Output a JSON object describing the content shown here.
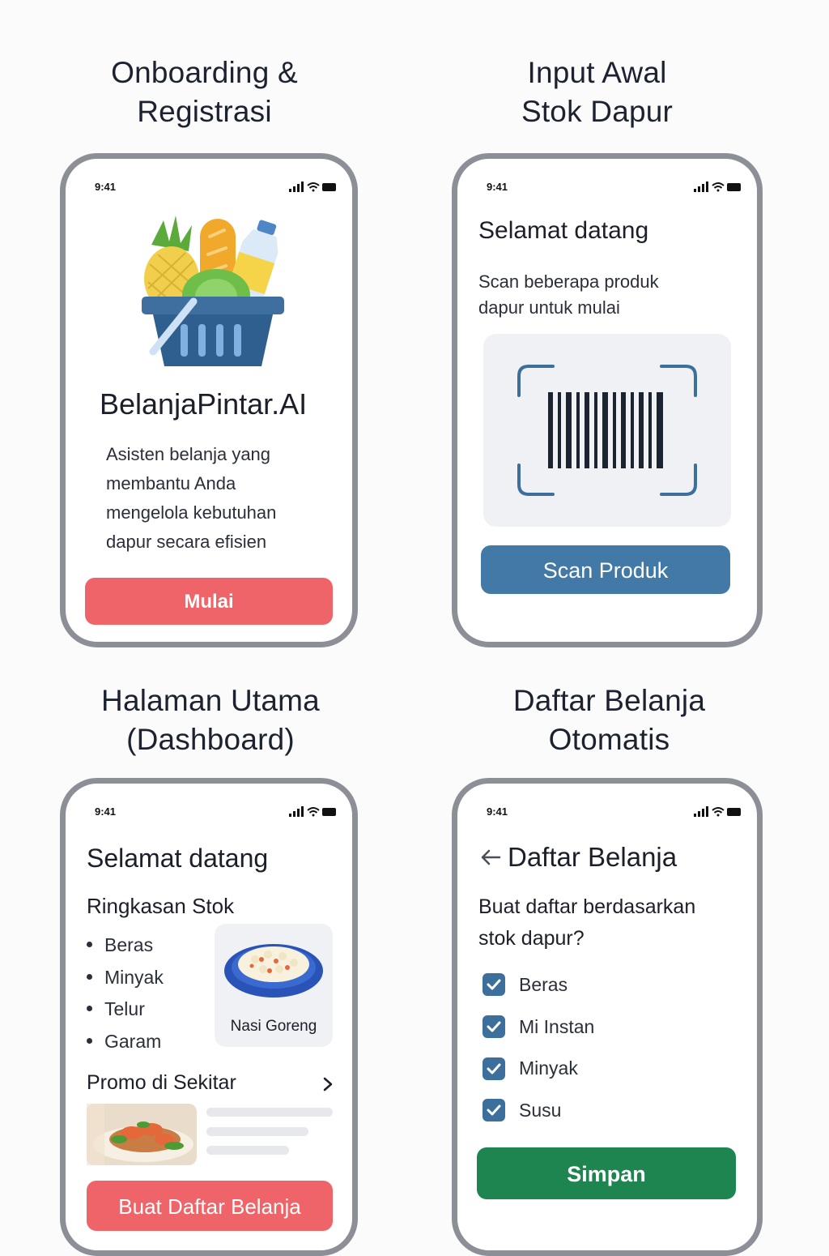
{
  "sections": [
    {
      "title_line1": "Onboarding &",
      "title_line2": "Registrasi"
    },
    {
      "title_line1": "Input Awal",
      "title_line2": "Stok Dapur"
    },
    {
      "title_line1": "Halaman Utama",
      "title_line2": "(Dashboard)"
    },
    {
      "title_line1": "Daftar Belanja",
      "title_line2": "Otomatis"
    }
  ],
  "status_time": "9:41",
  "onboarding": {
    "brand": "BelanjaPintar.AI",
    "description_lines": [
      "Asisten belanja yang",
      "membantu Anda",
      "mengelola kebutuhan",
      "dapur secara efisien"
    ],
    "button_label": "Mulai",
    "illustration_icon": "grocery-basket-icon"
  },
  "input_stok": {
    "title": "Selamat datang",
    "description_lines": [
      "Scan beberapa produk",
      "dapur untuk mulai"
    ],
    "scanner_icon": "barcode-scan-icon",
    "button_label": "Scan Produk"
  },
  "dashboard": {
    "title": "Selamat datang",
    "stock_heading": "Ringkasan Stok",
    "stock_items": [
      "Beras",
      "Minyak",
      "Telur",
      "Garam"
    ],
    "recipe_label": "Nasi Goreng",
    "promo_heading": "Promo di Sekitar",
    "button_label": "Buat Daftar Belanja"
  },
  "shopping_list": {
    "title": "Daftar Belanja",
    "question_lines": [
      "Buat daftar berdasarkan",
      "stok dapur?"
    ],
    "items": [
      "Beras",
      "Mi Instan",
      "Minyak",
      "Susu"
    ],
    "button_label": "Simpan"
  },
  "colors": {
    "red_button": "#ee6468",
    "blue_button": "#4379a6",
    "green_button": "#1f8550",
    "checkbox": "#3d6f9d"
  }
}
